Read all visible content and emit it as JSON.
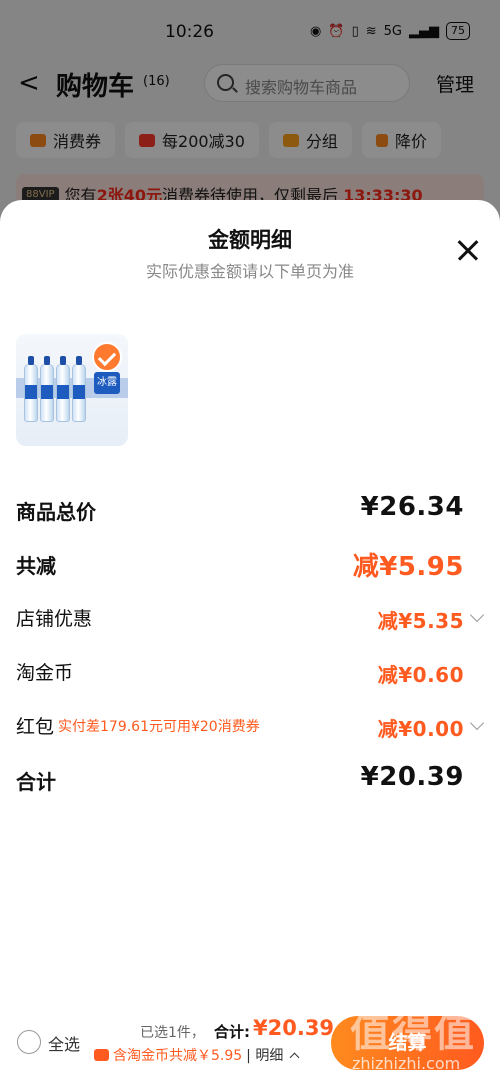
{
  "status_bar": {
    "time": "10:26",
    "network": "5G",
    "battery": "75"
  },
  "header": {
    "title": "购物车",
    "count": "(16)",
    "search_placeholder": "搜索购物车商品",
    "manage_label": "管理"
  },
  "chips": [
    {
      "label": "消费券",
      "icon": "coupon-icon"
    },
    {
      "label": "每200减30",
      "icon": "shop-icon"
    },
    {
      "label": "分组",
      "icon": "folder-icon"
    },
    {
      "label": "降价",
      "icon": "price-down-icon"
    }
  ],
  "vip_banner": {
    "badge": "88VIP",
    "text_prefix": "您有",
    "highlight": "2张40元",
    "text_middle": "消费券待使用，仅剩最后",
    "countdown": "13:33:30"
  },
  "sheet": {
    "title": "金额明细",
    "subtitle": "实际优惠金额请以下单页为准",
    "rows": {
      "subtotal_label": "商品总价",
      "subtotal_value": "¥26.34",
      "discount_label": "共减",
      "discount_value": "减¥5.95",
      "shop_label": "店铺优惠",
      "shop_value": "减¥5.35",
      "coin_label": "淘金币",
      "coin_value": "减¥0.60",
      "redpacket_label": "红包",
      "redpacket_note": "实付差179.61元可用¥20消费券",
      "redpacket_value": "减¥0.00",
      "total_label": "合计",
      "total_value": "¥20.39"
    },
    "product": {
      "brand": "冰露"
    }
  },
  "bottom_bar": {
    "select_all": "全选",
    "selected_info": "已选1件，",
    "total_label": "合计:",
    "total_amount": "¥20.39",
    "coin_note": "含淘金币共减￥5.95",
    "detail": "| 明细",
    "checkout": "结算"
  },
  "watermark": {
    "text": "值得值",
    "url": "zhizhizhi.com"
  },
  "colors": {
    "accent": "#ff5a1f",
    "vip_red": "#ff2a1a"
  }
}
